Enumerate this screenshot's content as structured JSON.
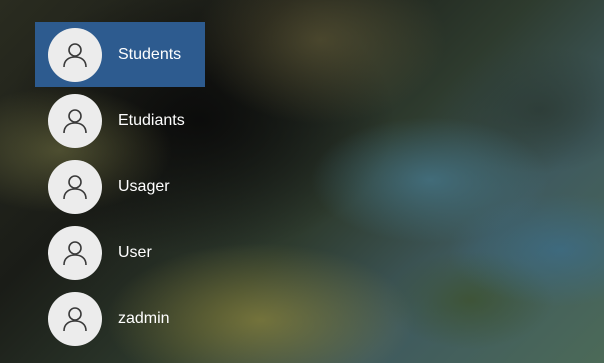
{
  "accounts": [
    {
      "label": "Students",
      "selected": true,
      "icon": "user-icon"
    },
    {
      "label": "Etudiants",
      "selected": false,
      "icon": "user-icon"
    },
    {
      "label": "Usager",
      "selected": false,
      "icon": "user-icon"
    },
    {
      "label": "User",
      "selected": false,
      "icon": "user-icon"
    },
    {
      "label": "zadmin",
      "selected": false,
      "icon": "user-icon"
    }
  ],
  "colors": {
    "selected_background": "#2d5b8f",
    "avatar_background": "#ececec",
    "avatar_glyph": "#3a3a3a",
    "label_text": "#ffffff"
  }
}
